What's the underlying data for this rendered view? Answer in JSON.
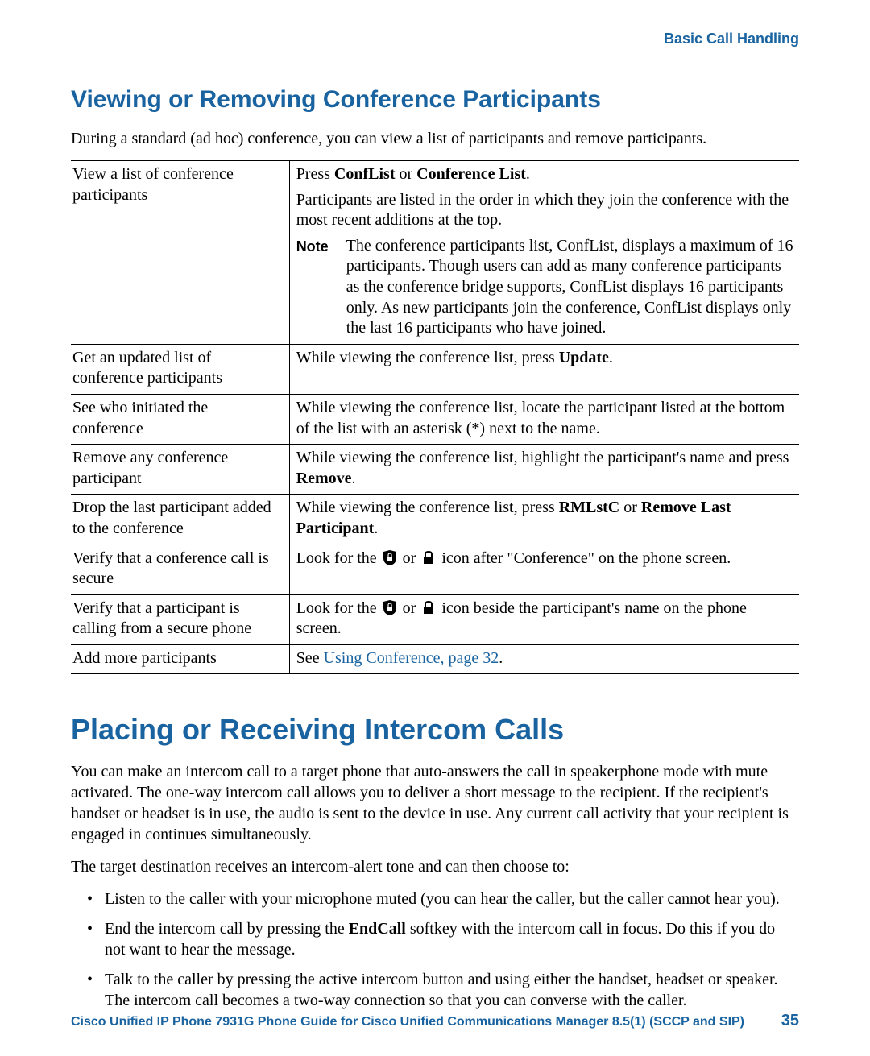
{
  "breadcrumb": "Basic Call Handling",
  "section1": {
    "heading": "Viewing or Removing Conference Participants",
    "intro": "During a standard (ad hoc) conference, you can view a list of participants and remove participants."
  },
  "table": {
    "r1": {
      "left": "View a list of conference participants",
      "p1a": "Press ",
      "p1b": "ConfList",
      "p1c": " or ",
      "p1d": "Conference List",
      "p1e": ".",
      "p2": "Participants are listed in the order in which they join the conference with the most recent additions at the top.",
      "noteLabel": "Note",
      "noteBody": "The conference participants list, ConfList, displays a maximum of 16 participants. Though users can add as many conference participants as the conference bridge supports, ConfList displays 16 participants only. As new participants join the conference, ConfList displays only the last 16 participants who have joined."
    },
    "r2": {
      "left": "Get an updated list of conference participants",
      "a": "While viewing the conference list, press ",
      "b": "Update",
      "c": "."
    },
    "r3": {
      "left": "See who initiated the conference",
      "right": "While viewing the conference list, locate the participant listed at the bottom of the list with an asterisk (*) next to the name."
    },
    "r4": {
      "left": "Remove any conference participant",
      "a": "While viewing the conference list, highlight the participant's name and press ",
      "b": "Remove",
      "c": "."
    },
    "r5": {
      "left": "Drop the last participant added to the conference",
      "a": "While viewing the conference list, press ",
      "b": "RMLstC",
      "c": " or ",
      "d": "Remove Last Participant",
      "e": "."
    },
    "r6": {
      "left": "Verify that a conference call is secure",
      "a": "Look for the ",
      "b": " or ",
      "c": " icon after \"Conference\" on the phone screen."
    },
    "r7": {
      "left": "Verify that a participant is calling from a secure phone",
      "a": "Look for the ",
      "b": " or ",
      "c": " icon beside the participant's name on the phone screen."
    },
    "r8": {
      "left": "Add more participants",
      "a": "See ",
      "link": "Using Conference, page 32",
      "c": "."
    }
  },
  "section2": {
    "heading": "Placing or Receiving Intercom Calls",
    "p1": "You can make an intercom call to a target phone that auto-answers the call in speakerphone mode with mute activated. The one-way intercom call allows you to deliver a short message to the recipient. If the recipient's handset or headset is in use, the audio is sent to the device in use. Any current call activity that your recipient is engaged in continues simultaneously.",
    "p2": "The target destination receives an intercom-alert tone and can then choose to:",
    "b1": "Listen to the caller with your microphone muted (you can hear the caller, but the caller cannot hear you).",
    "b2a": "End the intercom call by pressing the ",
    "b2b": "EndCall",
    "b2c": " softkey with the intercom call in focus. Do this if you do not want to hear the message.",
    "b3": "Talk to the caller by pressing the active intercom button and using either the handset, headset or speaker. The intercom call becomes a two-way connection so that you can converse with the caller."
  },
  "footer": {
    "title": "Cisco Unified IP Phone 7931G Phone Guide for Cisco Unified Communications Manager 8.5(1) (SCCP and SIP)",
    "page": "35"
  }
}
